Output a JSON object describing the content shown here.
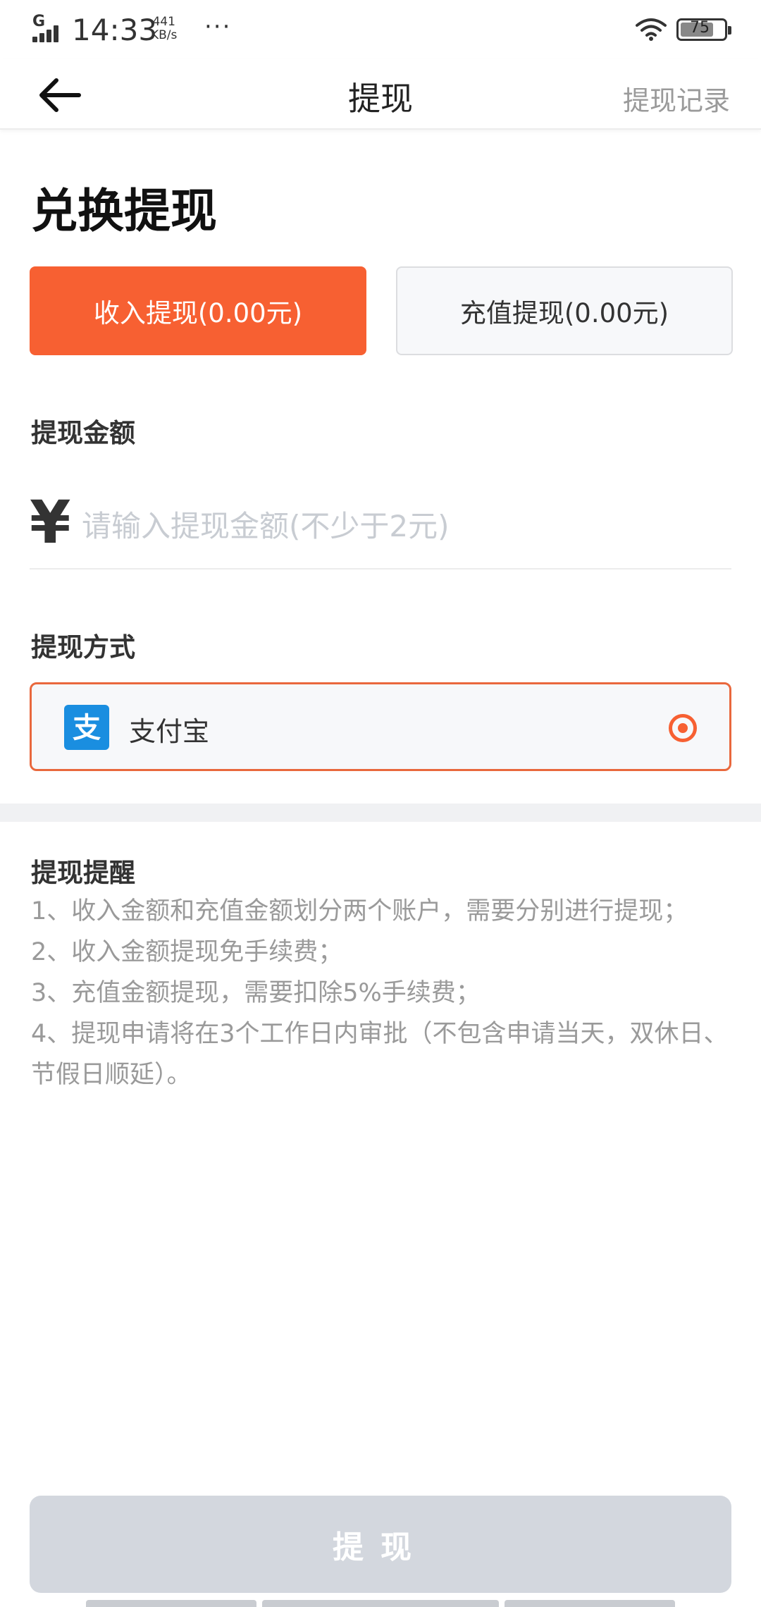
{
  "status_bar": {
    "network": "G",
    "time": "14:33",
    "speed_value": "441",
    "speed_unit": "KB/s",
    "dots": "···",
    "battery": "75"
  },
  "nav": {
    "title": "提现",
    "record_link": "提现记录"
  },
  "page_title": "兑换提现",
  "type_buttons": {
    "income": "收入提现(0.00元)",
    "recharge": "充值提现(0.00元)"
  },
  "amount": {
    "label": "提现金额",
    "currency_symbol": "¥",
    "placeholder": "请输入提现金额(不少于2元)"
  },
  "method": {
    "label": "提现方式",
    "name": "支付宝",
    "icon_char": "支"
  },
  "notes": {
    "title": "提现提醒",
    "items": [
      "1、收入金额和充值金额划分两个账户，需要分别进行提现；",
      "2、收入金额提现免手续费；",
      "3、充值金额提现，需要扣除5%手续费；",
      "4、提现申请将在3个工作日内审批（不包含申请当天，双休日、节假日顺延）。"
    ]
  },
  "submit_label": "提现",
  "colors": {
    "accent": "#f76032",
    "disabled_button": "#d3d7de",
    "alipay_blue": "#1a8ee0"
  }
}
